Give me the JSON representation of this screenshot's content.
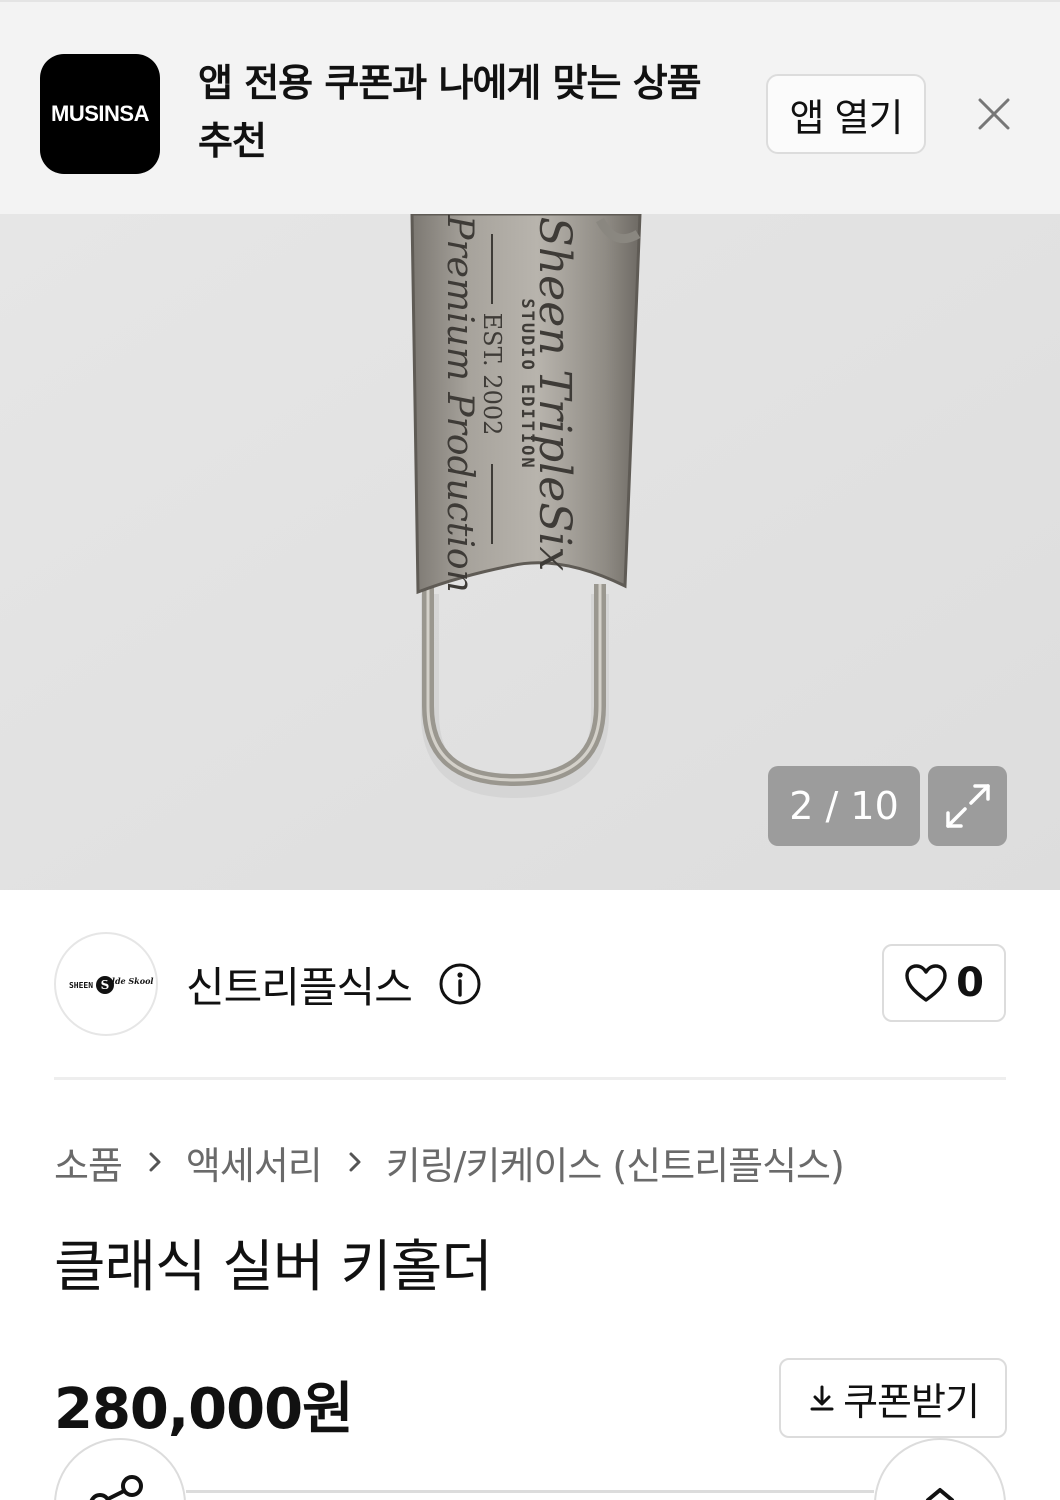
{
  "app_banner": {
    "logo_text": "MUSINSA",
    "message": "앱 전용 쿠폰과 나에게 맞는 상품 추천",
    "open_app_label": "앱 열기"
  },
  "gallery": {
    "counter": "2 / 10",
    "engraving": {
      "brand_script": "Sheen TripleSix",
      "studio_line": "STUDIO EDITION",
      "est_line": "EST. 2002",
      "production_script": "Premium Production"
    }
  },
  "brand": {
    "logo_text_left": "SHEEN",
    "logo_text_right": "olde Skool",
    "name": "신트리플식스",
    "like_count": "0"
  },
  "breadcrumb": [
    "소품",
    "액세서리",
    "키링/키케이스 (신트리플식스)"
  ],
  "product": {
    "title": "클래식 실버 키홀더",
    "price": "280,000원",
    "coupon_label": "쿠폰받기"
  },
  "icons": {
    "close": "close-icon",
    "expand": "expand-icon",
    "info": "info-icon",
    "heart": "heart-icon",
    "chevron": "chevron-right-icon",
    "download": "download-icon",
    "share": "share-icon",
    "top": "chevron-up-icon"
  }
}
